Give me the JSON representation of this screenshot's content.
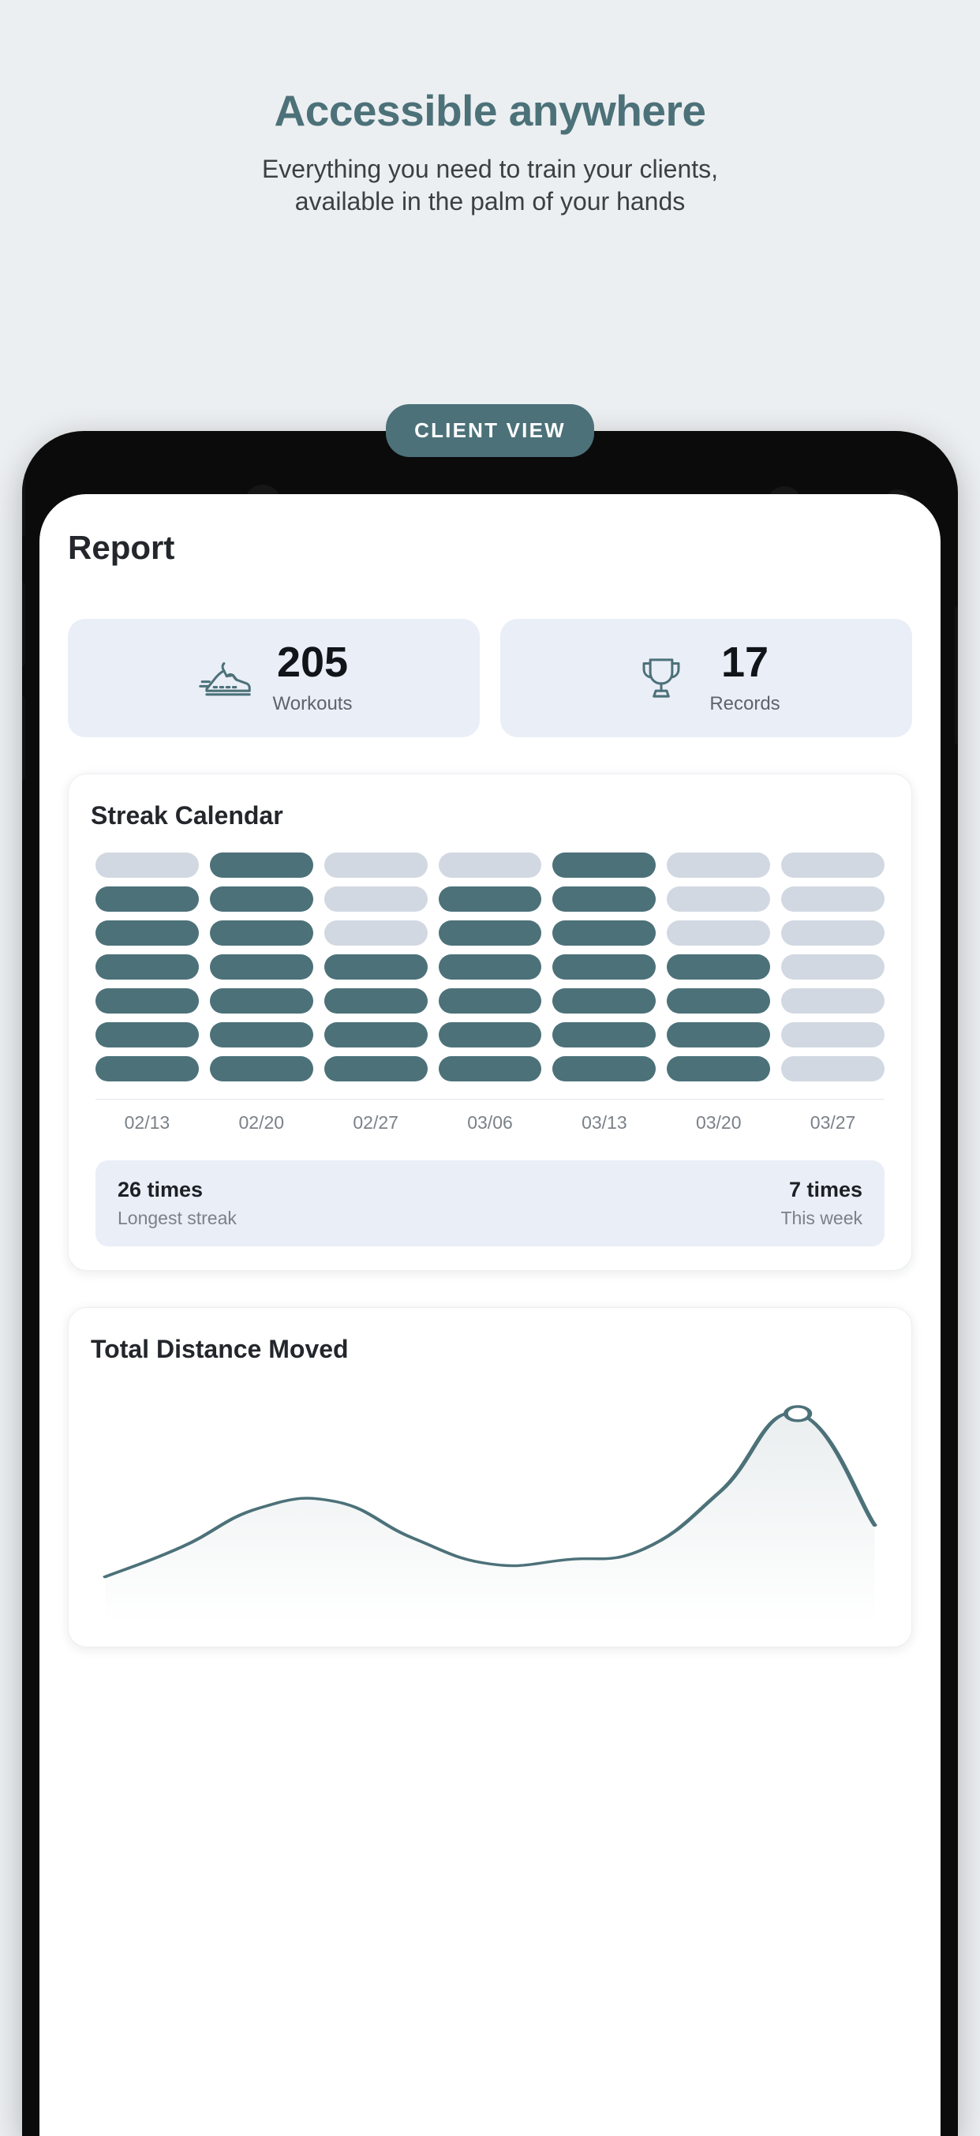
{
  "promo": {
    "title": "Accessible anywhere",
    "subtitle_line1": "Everything you need to train your clients,",
    "subtitle_line2": "available in the palm of your hands",
    "badge_label": "CLIENT VIEW"
  },
  "colors": {
    "page_background": "#eceff1",
    "accent_teal": "#4c7179",
    "cell_on": "#4c7179",
    "cell_off": "#d2d8e2",
    "card_tint": "#eaeef7",
    "text_dark": "#23262a",
    "text_muted": "#7b8188"
  },
  "app": {
    "screen_title": "Report",
    "stats": [
      {
        "icon": "running-shoe-icon",
        "value": "205",
        "label": "Workouts"
      },
      {
        "icon": "trophy-icon",
        "value": "17",
        "label": "Records"
      }
    ],
    "streak_card": {
      "title": "Streak Calendar",
      "date_labels": [
        "02/13",
        "02/20",
        "02/27",
        "03/06",
        "03/13",
        "03/20",
        "03/27"
      ],
      "grid": [
        [
          0,
          1,
          0,
          0,
          1,
          0,
          0
        ],
        [
          1,
          1,
          0,
          1,
          1,
          0,
          0
        ],
        [
          1,
          1,
          0,
          1,
          1,
          0,
          0
        ],
        [
          1,
          1,
          1,
          1,
          1,
          1,
          0
        ],
        [
          1,
          1,
          1,
          1,
          1,
          1,
          0
        ],
        [
          1,
          1,
          1,
          1,
          1,
          1,
          0
        ],
        [
          1,
          1,
          1,
          1,
          1,
          1,
          0
        ]
      ],
      "summary_left_value": "26 times",
      "summary_left_label": "Longest streak",
      "summary_right_value": "7 times",
      "summary_right_label": "This week"
    },
    "distance_card": {
      "title": "Total Distance Moved"
    }
  },
  "chart_data": {
    "type": "line",
    "title": "Total Distance Moved",
    "x": [
      0,
      1,
      2,
      3,
      4,
      5,
      6,
      7,
      8,
      9,
      10
    ],
    "values": [
      20,
      34,
      52,
      55,
      38,
      26,
      28,
      33,
      60,
      96,
      44
    ],
    "highlight_point": {
      "x": 9,
      "y": 96
    },
    "xlabel": "",
    "ylabel": "",
    "ylim": [
      0,
      100
    ],
    "grid": false,
    "legend": "none",
    "line_color": "#4c7179",
    "fill": "gradient"
  }
}
